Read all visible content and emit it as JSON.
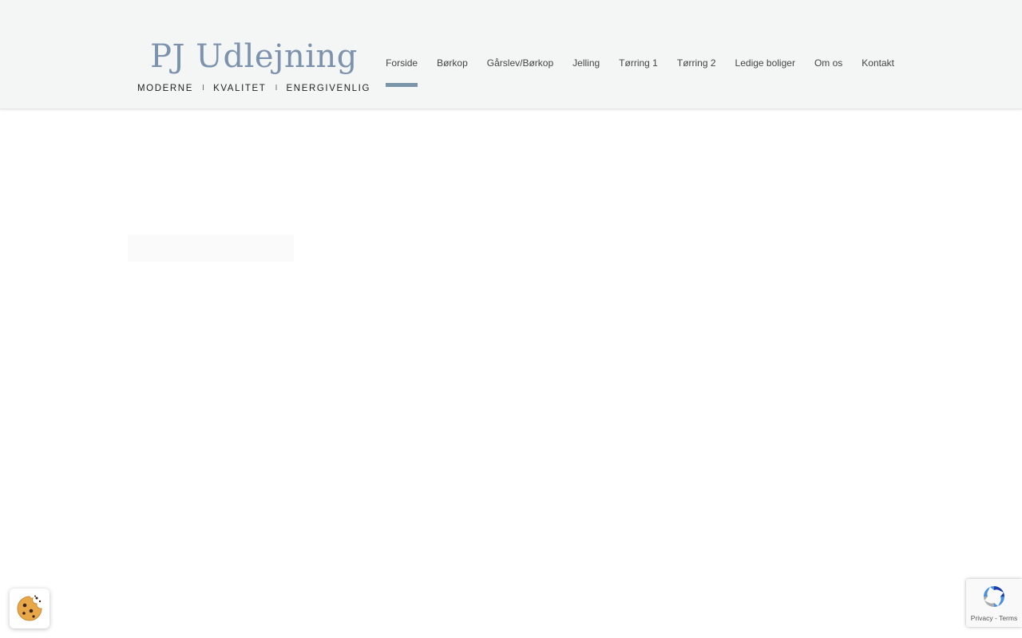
{
  "logo": {
    "title": "PJ Udlejning",
    "tagline": [
      "MODERNE",
      "KVALITET",
      "ENERGIVENLIG"
    ],
    "separator": "I"
  },
  "nav": {
    "items": [
      {
        "label": "Forside",
        "active": true
      },
      {
        "label": "Børkop"
      },
      {
        "label": "Gårslev/Børkop"
      },
      {
        "label": "Jelling"
      },
      {
        "label": "Tørring 1"
      },
      {
        "label": "Tørring 2"
      },
      {
        "label": "Ledige boliger"
      },
      {
        "label": "Om os"
      },
      {
        "label": "Kontakt"
      }
    ]
  },
  "colors": {
    "header_bg": "#f4f5f5",
    "brand": "#7d93ad",
    "active_underline": "#7a94a8"
  },
  "cookie": {
    "icon": "cookie-icon"
  },
  "recaptcha": {
    "icon": "recaptcha-icon",
    "privacy": "Privacy",
    "separator": " - ",
    "terms": "Terms"
  }
}
